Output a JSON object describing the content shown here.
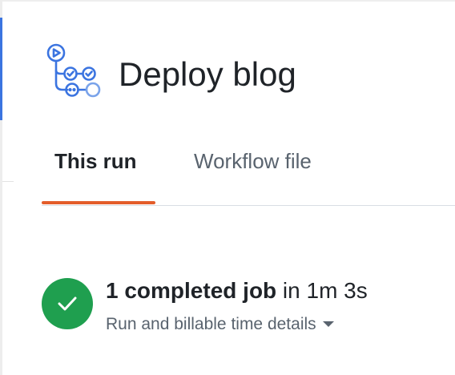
{
  "header": {
    "title": "Deploy blog",
    "icon": "workflow-icon"
  },
  "tabs": [
    {
      "label": "This run",
      "selected": true
    },
    {
      "label": "Workflow file",
      "selected": false
    }
  ],
  "summary": {
    "status_icon": "check-circle-icon",
    "status_color": "#1f9f4f",
    "jobs_label": "1 completed job",
    "duration_text": " in 1m 3s",
    "billable_label": "Run and billable time details"
  },
  "colors": {
    "accent": "#e35d2a",
    "icon_blue": "#3b74e0",
    "muted": "#59636e"
  }
}
